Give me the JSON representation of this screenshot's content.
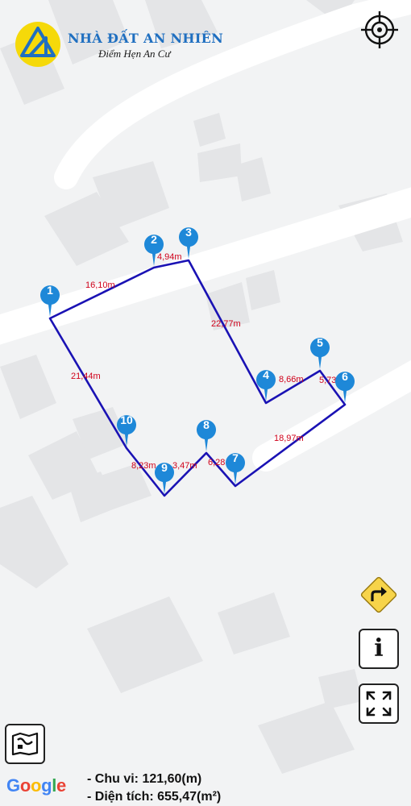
{
  "brand": {
    "title": "NHÀ ĐẤT AN NHIÊN",
    "subtitle": "Điểm Hẹn An Cư",
    "primary_color": "#1f6fc0",
    "accent_color": "#f5d90a"
  },
  "map": {
    "boundary_color": "#1a12b4",
    "pin_color": "#1e88d8",
    "label_color": "#d0021b",
    "segment_labels": [
      "16,10m",
      "4,94m",
      "22,77m",
      "8,66m",
      "5,73",
      "18,97m",
      "6,28",
      "3,47m",
      "8,23m",
      "21,44m"
    ],
    "pins": [
      "1",
      "2",
      "3",
      "4",
      "5",
      "6",
      "7",
      "8",
      "9",
      "10"
    ]
  },
  "controls": {
    "locate_icon": "crosshair-icon",
    "directions_icon": "turn-right-sign-icon",
    "info_icon": "info-icon",
    "info_label": "i",
    "fullscreen_icon": "fullscreen-icon",
    "map_type_icon": "map-layers-icon"
  },
  "attribution": {
    "google": [
      "G",
      "o",
      "o",
      "g",
      "l",
      "e"
    ],
    "google_colors": [
      "#4285F4",
      "#EA4335",
      "#FBBC05",
      "#4285F4",
      "#34A853",
      "#EA4335"
    ]
  },
  "summary": {
    "perimeter": "- Chu vi: 121,60(m)",
    "area": "- Diện tích: 655,47(m²)"
  }
}
